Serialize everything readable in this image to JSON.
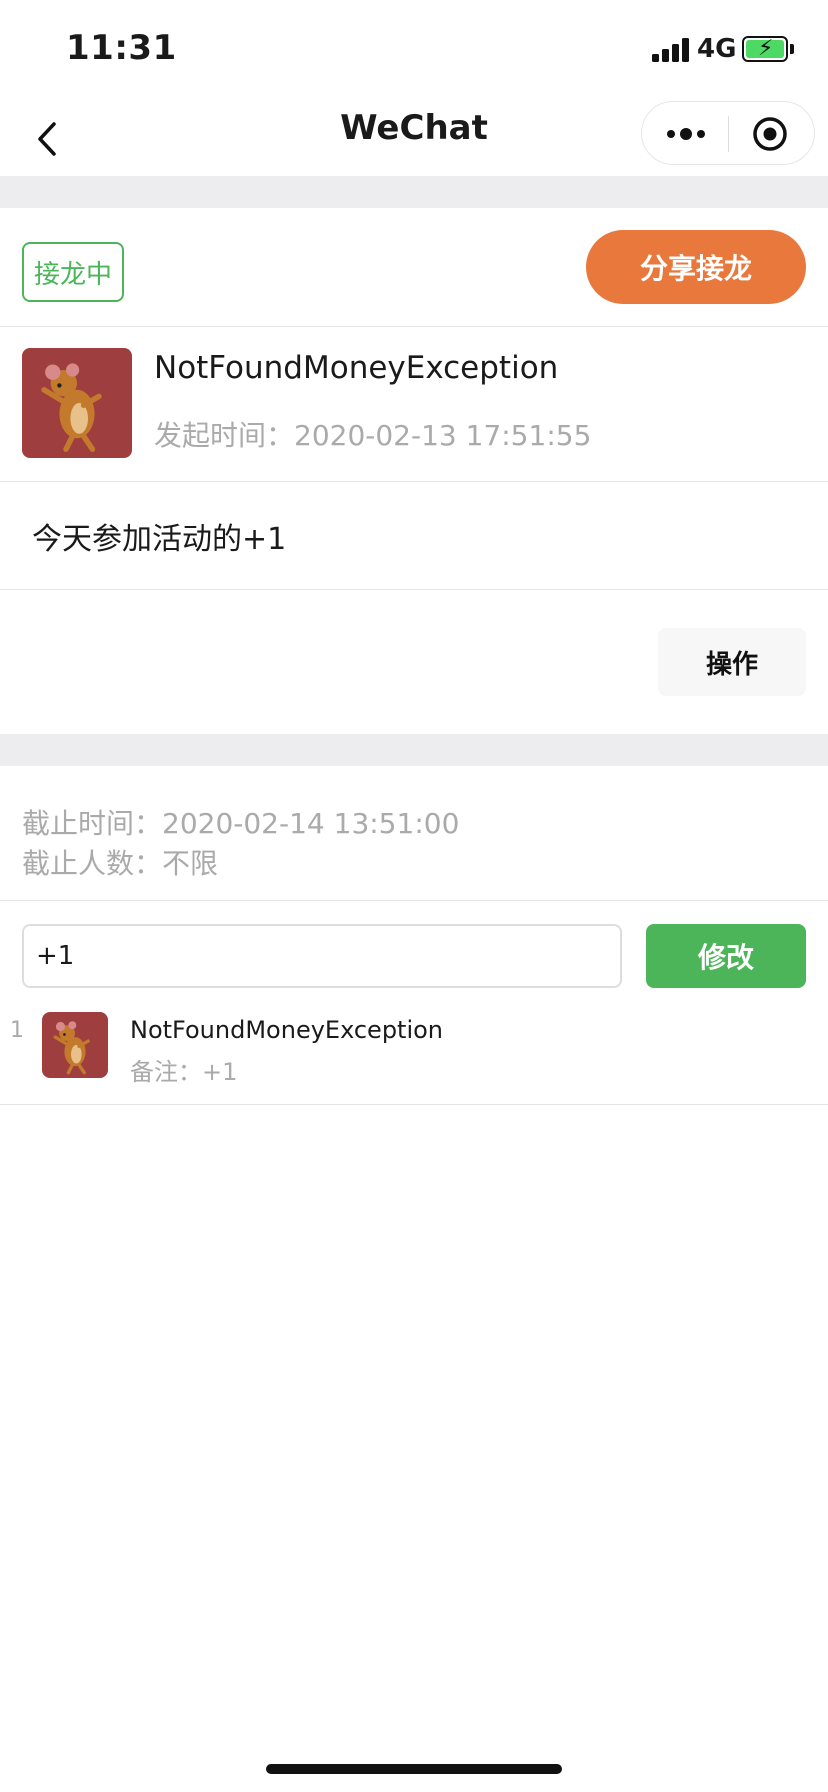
{
  "status_bar": {
    "time": "11:31",
    "network": "4G"
  },
  "nav": {
    "title": "WeChat"
  },
  "header": {
    "status_tag": "接龙中",
    "share_label": "分享接龙"
  },
  "creator": {
    "name": "NotFoundMoneyException",
    "created_time": "发起时间：2020-02-13 17:51:55"
  },
  "description": "今天参加活动的+1",
  "operation_label": "操作",
  "deadline": {
    "time": "截止时间：2020-02-14 13:51:00",
    "count": "截止人数：不限"
  },
  "entry_form": {
    "value": "+1",
    "submit_label": "修改"
  },
  "participants": [
    {
      "index": "1",
      "name": "NotFoundMoneyException",
      "note": "备注：+1"
    }
  ],
  "colors": {
    "accent_green": "#4cb55a",
    "share_orange": "#e8783c",
    "avatar_bg": "#9e3e3e"
  }
}
